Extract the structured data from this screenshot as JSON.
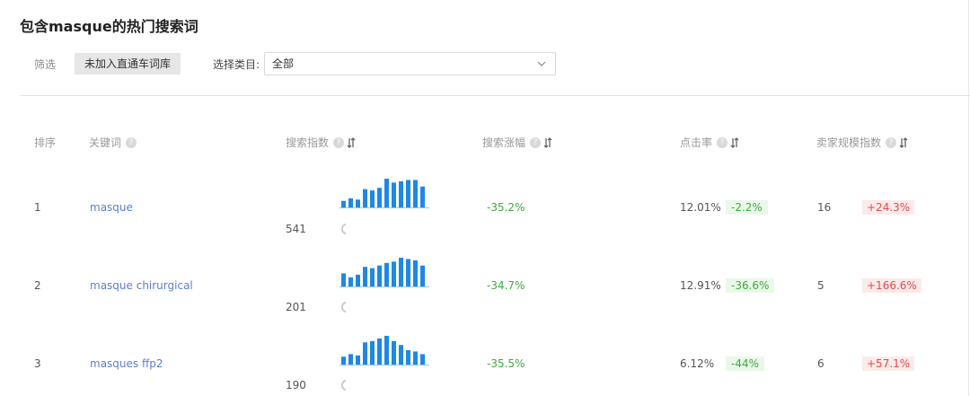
{
  "title": "包含masque的热门搜索词",
  "filter": {
    "label": "筛选",
    "tag": "未加入直通车词库"
  },
  "category": {
    "label": "选择类目:",
    "value": "全部"
  },
  "columns": {
    "rank": "排序",
    "keyword": "关键词",
    "search_index": "搜索指数",
    "search_growth": "搜索涨幅",
    "ctr": "点击率",
    "seller_index": "卖家规模指数"
  },
  "colors": {
    "bar": "#1e88e5",
    "green": "#3daa3d",
    "red": "#e34b4b"
  },
  "rows": [
    {
      "rank": "1",
      "keyword": "masque",
      "search_index": "541",
      "growth": "-35.2%",
      "ctr": "12.01%",
      "ctr_change": "-2.2%",
      "seller_index": "16",
      "seller_change": "+24.3%",
      "trend": [
        0.25,
        0.35,
        0.3,
        0.7,
        0.65,
        0.75,
        1.1,
        0.95,
        1.0,
        1.05,
        1.05,
        0.8
      ]
    },
    {
      "rank": "2",
      "keyword": "masque chirurgical",
      "search_index": "201",
      "growth": "-34.7%",
      "ctr": "12.91%",
      "ctr_change": "-36.6%",
      "seller_index": "5",
      "seller_change": "+166.6%",
      "trend": [
        0.5,
        0.35,
        0.45,
        0.75,
        0.7,
        0.8,
        0.9,
        0.95,
        1.1,
        1.05,
        1.0,
        0.8
      ]
    },
    {
      "rank": "3",
      "keyword": "masques ffp2",
      "search_index": "190",
      "growth": "-35.5%",
      "ctr": "6.12%",
      "ctr_change": "-44%",
      "seller_index": "6",
      "seller_change": "+57.1%",
      "trend": [
        0.3,
        0.4,
        0.35,
        0.85,
        0.9,
        1.0,
        1.1,
        0.9,
        0.75,
        0.55,
        0.5,
        0.4
      ]
    }
  ]
}
